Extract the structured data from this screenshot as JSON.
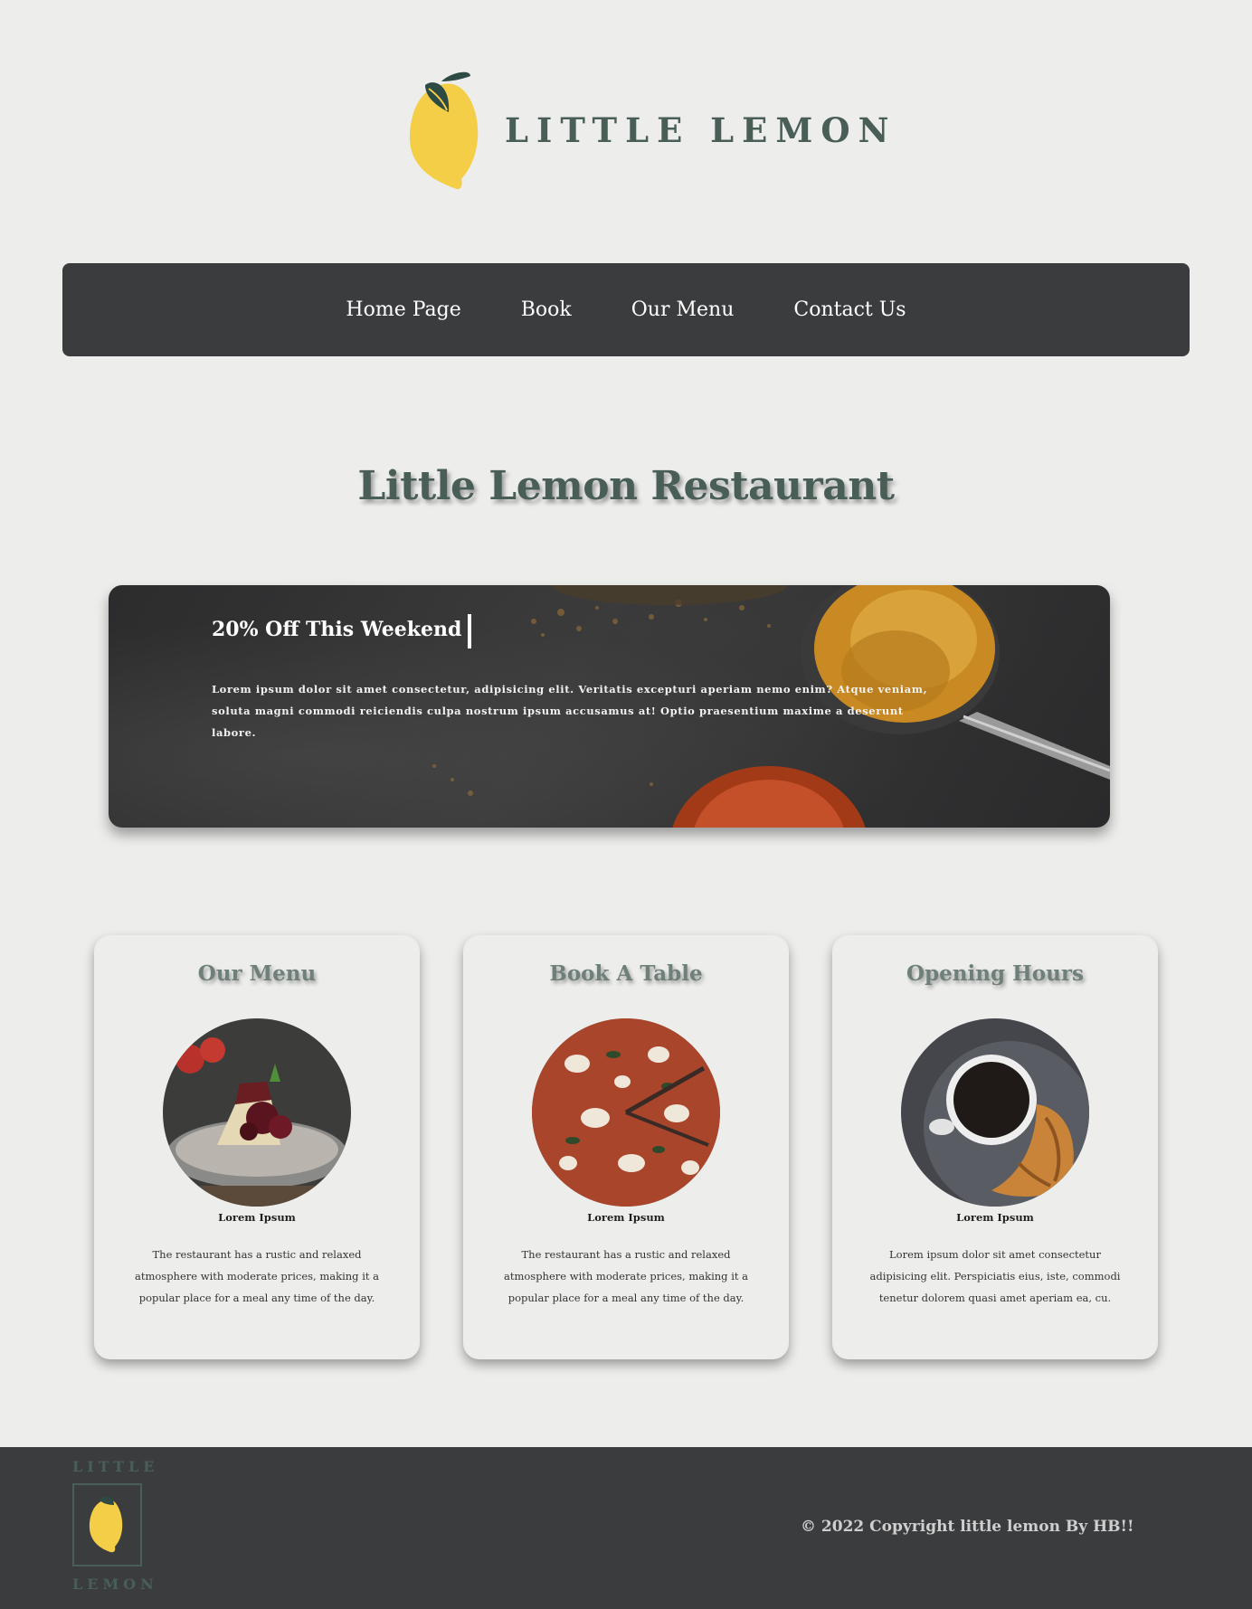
{
  "brand": {
    "wordmark": "LITTLE LEMON",
    "colors": {
      "green": "#495e57",
      "yellow": "#f4ce47",
      "dark": "#3b3c3e",
      "background": "#edeeec"
    }
  },
  "nav": {
    "items": [
      {
        "label": "Home Page"
      },
      {
        "label": "Book"
      },
      {
        "label": "Our Menu"
      },
      {
        "label": "Contact Us"
      }
    ]
  },
  "hero": {
    "title": "Little Lemon Restaurant"
  },
  "promo": {
    "title": "20% Off This Weekend",
    "text": "Lorem ipsum dolor sit amet consectetur, adipisicing elit. Veritatis excepturi aperiam nemo enim? Atque veniam, soluta magni commodi reiciendis culpa nostrum ipsum accusamus at! Optio praesentium maxime a deserunt labore."
  },
  "cards": [
    {
      "title": "Our Menu",
      "image": "dessert-photo",
      "caption": "Lorem Ipsum",
      "body": "The restaurant has a rustic and relaxed atmosphere with moderate prices, making it a popular place for a meal any time of the day."
    },
    {
      "title": "Book A Table",
      "image": "pizza-photo",
      "caption": "Lorem Ipsum",
      "body": "The restaurant has a rustic and relaxed atmosphere with moderate prices, making it a popular place for a meal any time of the day."
    },
    {
      "title": "Opening Hours",
      "image": "coffee-croissant-photo",
      "caption": "Lorem Ipsum",
      "body": "Lorem ipsum dolor sit amet consectetur adipisicing elit. Perspiciatis eius, iste, commodi tenetur dolorem quasi amet aperiam ea, cu."
    }
  ],
  "footer": {
    "logo_top": "LITTLE",
    "logo_bottom": "LEMON",
    "copyright": "© 2022 Copyright little lemon By HB!!"
  }
}
